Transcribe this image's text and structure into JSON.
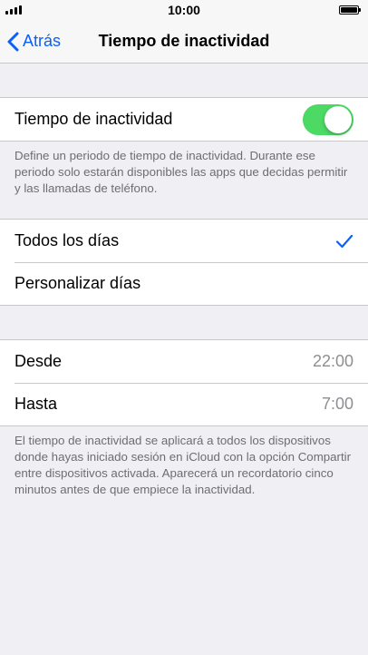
{
  "status_bar": {
    "time": "10:00"
  },
  "nav": {
    "back_label": "Atrás",
    "title": "Tiempo de inactividad"
  },
  "downtime_toggle": {
    "label": "Tiempo de inactividad",
    "on": true,
    "on_color": "#4cd964"
  },
  "downtime_description": "Define un periodo de tiempo de inactividad. Durante ese periodo solo estarán disponibles las apps que decidas permitir y las llamadas de teléfono.",
  "schedule": {
    "every_day": {
      "label": "Todos los días",
      "selected": true
    },
    "custom_days": {
      "label": "Personalizar días",
      "selected": false
    }
  },
  "time_range": {
    "from": {
      "label": "Desde",
      "value": "22:00"
    },
    "to": {
      "label": "Hasta",
      "value": "7:00"
    }
  },
  "time_range_note": "El tiempo de inactividad se aplicará a todos los dispositivos donde hayas iniciado sesión en iCloud con la opción Compartir entre dispositivos activada. Aparecerá un recordatorio cinco minutos antes de que empiece la inactividad.",
  "colors": {
    "accent": "#0a60ff",
    "background": "#efeff4",
    "secondary_text": "#6d6d72"
  }
}
